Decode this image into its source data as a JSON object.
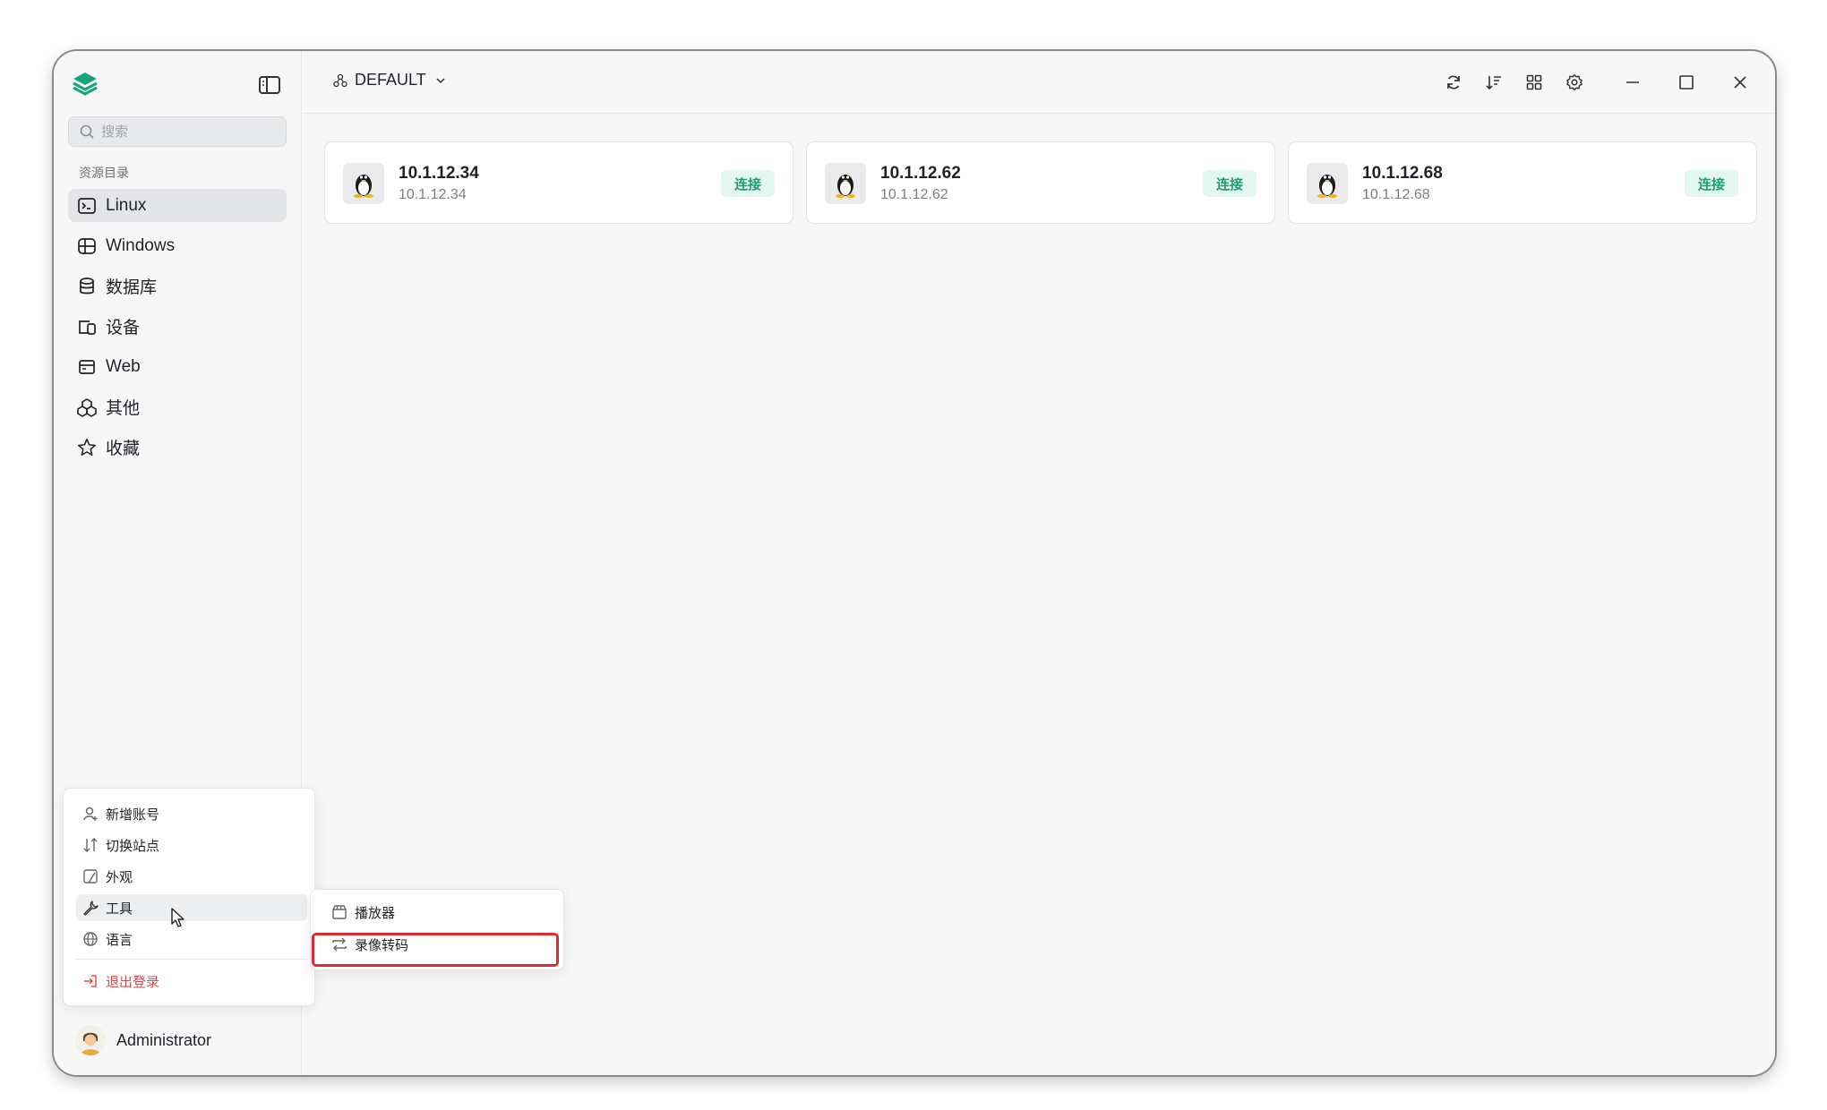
{
  "sidebar": {
    "search_placeholder": "搜索",
    "section_title": "资源目录",
    "items": [
      {
        "label": "Linux",
        "icon": "terminal-icon",
        "active": true
      },
      {
        "label": "Windows",
        "icon": "windows-icon"
      },
      {
        "label": "数据库",
        "icon": "database-icon"
      },
      {
        "label": "设备",
        "icon": "device-icon"
      },
      {
        "label": "Web",
        "icon": "web-icon"
      },
      {
        "label": "其他",
        "icon": "other-icon"
      },
      {
        "label": "收藏",
        "icon": "star-icon"
      }
    ],
    "user_name": "Administrator"
  },
  "topbar": {
    "workspace": "DEFAULT",
    "tools": [
      "refresh-icon",
      "sort-icon",
      "grid-view-icon",
      "settings-icon",
      "minimize-icon",
      "maximize-icon",
      "close-icon"
    ]
  },
  "cards": [
    {
      "name": "10.1.12.34",
      "host": "10.1.12.34",
      "action": "连接"
    },
    {
      "name": "10.1.12.62",
      "host": "10.1.12.62",
      "action": "连接"
    },
    {
      "name": "10.1.12.68",
      "host": "10.1.12.68",
      "action": "连接"
    }
  ],
  "user_menu": {
    "items": [
      {
        "label": "新增账号",
        "icon": "add-user-icon"
      },
      {
        "label": "切换站点",
        "icon": "switch-icon"
      },
      {
        "label": "外观",
        "icon": "appearance-icon"
      },
      {
        "label": "工具",
        "icon": "wrench-icon",
        "hover": true
      },
      {
        "label": "语言",
        "icon": "globe-icon"
      }
    ],
    "logout": "退出登录"
  },
  "tools_submenu": {
    "items": [
      {
        "label": "播放器",
        "icon": "player-icon"
      },
      {
        "label": "录像转码",
        "icon": "transcode-icon",
        "highlighted": true
      }
    ]
  },
  "colors": {
    "accent": "#1e9e6e",
    "danger": "#e5484d",
    "highlight_box": "#e02a2f"
  }
}
